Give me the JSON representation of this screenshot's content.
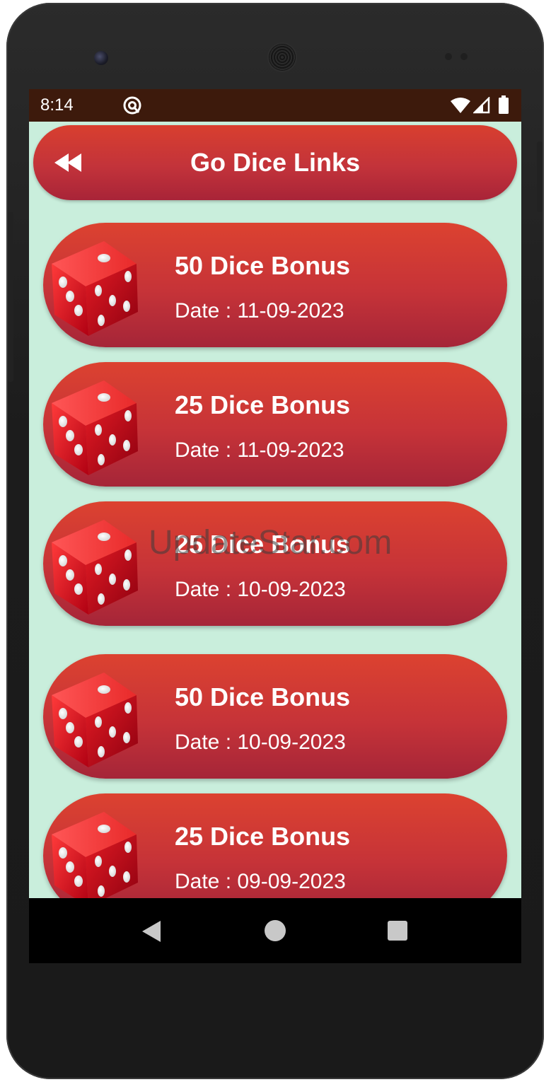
{
  "status_bar": {
    "time": "8:14",
    "icons": [
      "at-sign-icon",
      "wifi-icon",
      "signal-icon",
      "battery-icon"
    ]
  },
  "header": {
    "back_icon": "rewind-icon",
    "title": "Go Dice Links"
  },
  "cards": [
    {
      "title": "50 Dice Bonus",
      "date": "Date : 11-09-2023"
    },
    {
      "title": "25 Dice Bonus",
      "date": "Date : 11-09-2023"
    },
    {
      "title": "25 Dice Bonus",
      "date": "Date : 10-09-2023"
    },
    {
      "title": "50 Dice Bonus",
      "date": "Date : 10-09-2023"
    },
    {
      "title": "25 Dice Bonus",
      "date": "Date : 09-09-2023"
    }
  ],
  "watermark": "UpdateStar.com",
  "navigation": {
    "icons": [
      "back-triangle-icon",
      "home-circle-icon",
      "recents-square-icon"
    ]
  },
  "colors": {
    "app_background": "#c9eedc",
    "card_red": "#c63338",
    "status_bar": "#3d1a0c"
  }
}
